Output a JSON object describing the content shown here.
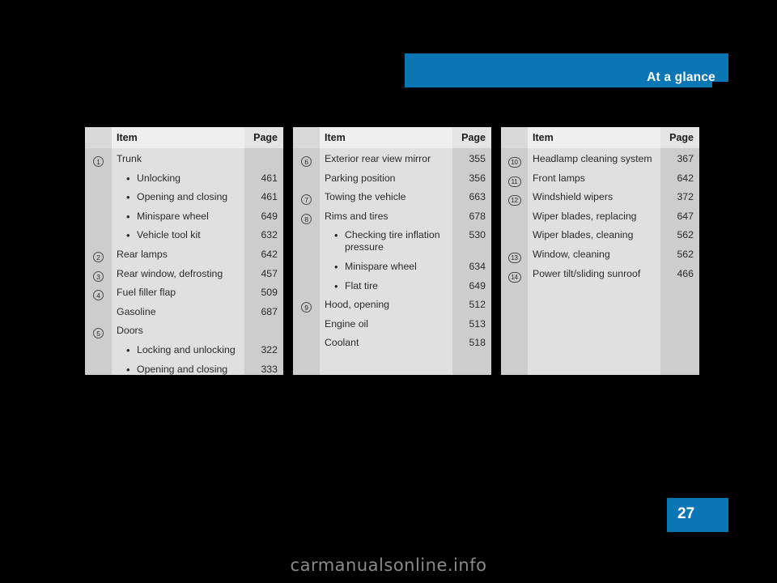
{
  "header": {
    "title": "At a glance",
    "banner_color": "#0a76b4"
  },
  "footer": {
    "page_number": "27",
    "watermark": "carmanualsonline.info"
  },
  "tables": [
    {
      "columns": {
        "item": "Item",
        "page": "Page"
      },
      "rows": [
        {
          "num": "1",
          "level": "top",
          "text": "Trunk",
          "page": ""
        },
        {
          "num": "",
          "level": "sub",
          "text": "Unlocking",
          "page": "461"
        },
        {
          "num": "",
          "level": "sub",
          "text": "Opening and closing",
          "page": "461"
        },
        {
          "num": "",
          "level": "sub",
          "text": "Minispare wheel",
          "page": "649"
        },
        {
          "num": "",
          "level": "sub",
          "text": "Vehicle tool kit",
          "page": "632"
        },
        {
          "num": "2",
          "level": "top",
          "text": "Rear lamps",
          "page": "642"
        },
        {
          "num": "3",
          "level": "top",
          "text": "Rear window, defrosting",
          "page": "457"
        },
        {
          "num": "4",
          "level": "top",
          "text": "Fuel filler flap",
          "page": "509"
        },
        {
          "num": "",
          "level": "top",
          "text": "Gasoline",
          "page": "687"
        },
        {
          "num": "5",
          "level": "top",
          "text": "Doors",
          "page": ""
        },
        {
          "num": "",
          "level": "sub",
          "text": "Locking and unlocking",
          "page": "322"
        },
        {
          "num": "",
          "level": "sub",
          "text": "Opening and closing",
          "page": "333"
        }
      ]
    },
    {
      "columns": {
        "item": "Item",
        "page": "Page"
      },
      "rows": [
        {
          "num": "6",
          "level": "top",
          "text": "Exterior rear view mirror",
          "page": "355"
        },
        {
          "num": "",
          "level": "top",
          "text": "Parking position",
          "page": "356"
        },
        {
          "num": "7",
          "level": "top",
          "text": "Towing the vehicle",
          "page": "663"
        },
        {
          "num": "8",
          "level": "top",
          "text": "Rims and tires",
          "page": "678"
        },
        {
          "num": "",
          "level": "sub",
          "text": "Checking tire inflation pressure",
          "page": "530"
        },
        {
          "num": "",
          "level": "sub",
          "text": "Minispare wheel",
          "page": "634"
        },
        {
          "num": "",
          "level": "sub",
          "text": "Flat tire",
          "page": "649"
        },
        {
          "num": "9",
          "level": "top",
          "text": "Hood, opening",
          "page": "512"
        },
        {
          "num": "",
          "level": "top",
          "text": "Engine oil",
          "page": "513"
        },
        {
          "num": "",
          "level": "top",
          "text": "Coolant",
          "page": "518"
        }
      ]
    },
    {
      "columns": {
        "item": "Item",
        "page": "Page"
      },
      "rows": [
        {
          "num": "10",
          "level": "top",
          "text": "Headlamp cleaning system",
          "page": "367"
        },
        {
          "num": "11",
          "level": "top",
          "text": "Front lamps",
          "page": "642"
        },
        {
          "num": "12",
          "level": "top",
          "text": "Windshield wipers",
          "page": "372"
        },
        {
          "num": "",
          "level": "top",
          "text": "Wiper blades, replacing",
          "page": "647"
        },
        {
          "num": "",
          "level": "top",
          "text": "Wiper blades, cleaning",
          "page": "562"
        },
        {
          "num": "13",
          "level": "top",
          "text": "Window, cleaning",
          "page": "562"
        },
        {
          "num": "14",
          "level": "top",
          "text": "Power tilt/sliding sunroof",
          "page": "466"
        }
      ]
    }
  ]
}
